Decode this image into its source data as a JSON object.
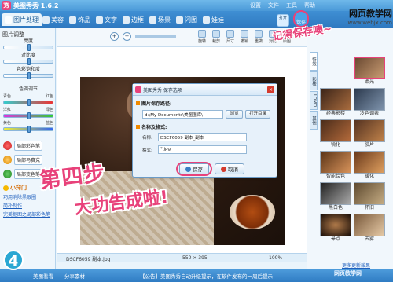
{
  "app": {
    "title": "美图秀秀 1.6.2",
    "logo": "秀"
  },
  "menus": [
    "设置",
    "文件",
    "工具",
    "帮助"
  ],
  "tabs": [
    {
      "label": "图片处理",
      "active": true
    },
    {
      "label": "美容"
    },
    {
      "label": "饰品"
    },
    {
      "label": "文字"
    },
    {
      "label": "边框"
    },
    {
      "label": "场景"
    },
    {
      "label": "闪图"
    },
    {
      "label": "娃娃"
    }
  ],
  "top_tools": {
    "open": "打开",
    "save": "保存"
  },
  "brand": {
    "line1": "网页教学网",
    "line2": "www.webjx.com"
  },
  "annotations": {
    "remember_save": "记得保存噢~",
    "step_title": "第四步",
    "step_sub": "大功告成啦!",
    "step_number": "4"
  },
  "left_panel": {
    "header": "图片调整",
    "sliders": [
      {
        "label": "亮度",
        "level": 0.5
      },
      {
        "label": "对比度",
        "level": 0.5
      },
      {
        "label": "色彩饱和度",
        "level": 0.5
      }
    ],
    "color_header": "色调调节",
    "color_sliders": [
      {
        "left": "青色",
        "right": "红色",
        "level": 0.5
      },
      {
        "left": "洋红",
        "right": "绿色",
        "level": 0.5
      },
      {
        "left": "黄色",
        "right": "蓝色",
        "level": 0.5
      }
    ],
    "buttons": [
      "局部彩色笔",
      "局部马赛克",
      "局部变色笔"
    ],
    "tips_title": "小窍门",
    "tips_links": [
      "巧用消除黑眼圈",
      "简朴制作",
      "完美抠图之局部彩色笔"
    ]
  },
  "canvas_toolbar": {
    "tools": [
      "旋转",
      "裁剪",
      "尺寸",
      "撤销",
      "重做",
      "对比",
      "原图"
    ]
  },
  "dialog": {
    "title": "美图秀秀 保存选项",
    "close": "×",
    "path_section": "图片保存路径:",
    "path_value": "d:\\My Documents\\美图图库\\",
    "browse": "浏览",
    "open_dir": "打开目录",
    "name_section": "名称及格式:",
    "name_label": "名称:",
    "name_value": "DSCF6059 副本_副本",
    "format_label": "格式:",
    "format_value": "*.jpg",
    "save_btn": "保存",
    "cancel_btn": "取消"
  },
  "right_panel": {
    "vtabs": [
      "特效",
      "影楼",
      "LOMO",
      "其他"
    ],
    "effects": [
      "柔光",
      "经典影楼",
      "冷色调表",
      "锐化",
      "胶片",
      "智能绘色",
      "暖化",
      "黑白色",
      "怀旧",
      "晕点",
      "去雾"
    ],
    "more_link": "更多更新效果"
  },
  "status": {
    "filename": "DSCF6059 副本.jpg",
    "size": "550 × 395",
    "zoom": "100%"
  },
  "bottom": {
    "items": [
      "美图看看",
      "分享素材",
      "【公告】美图秀秀自动升级提示，在软件发布的一周后提示"
    ],
    "watermark": "网页教学网"
  },
  "colors": {
    "accent": "#e8427a",
    "brand_blue": "#3f8fd3"
  }
}
